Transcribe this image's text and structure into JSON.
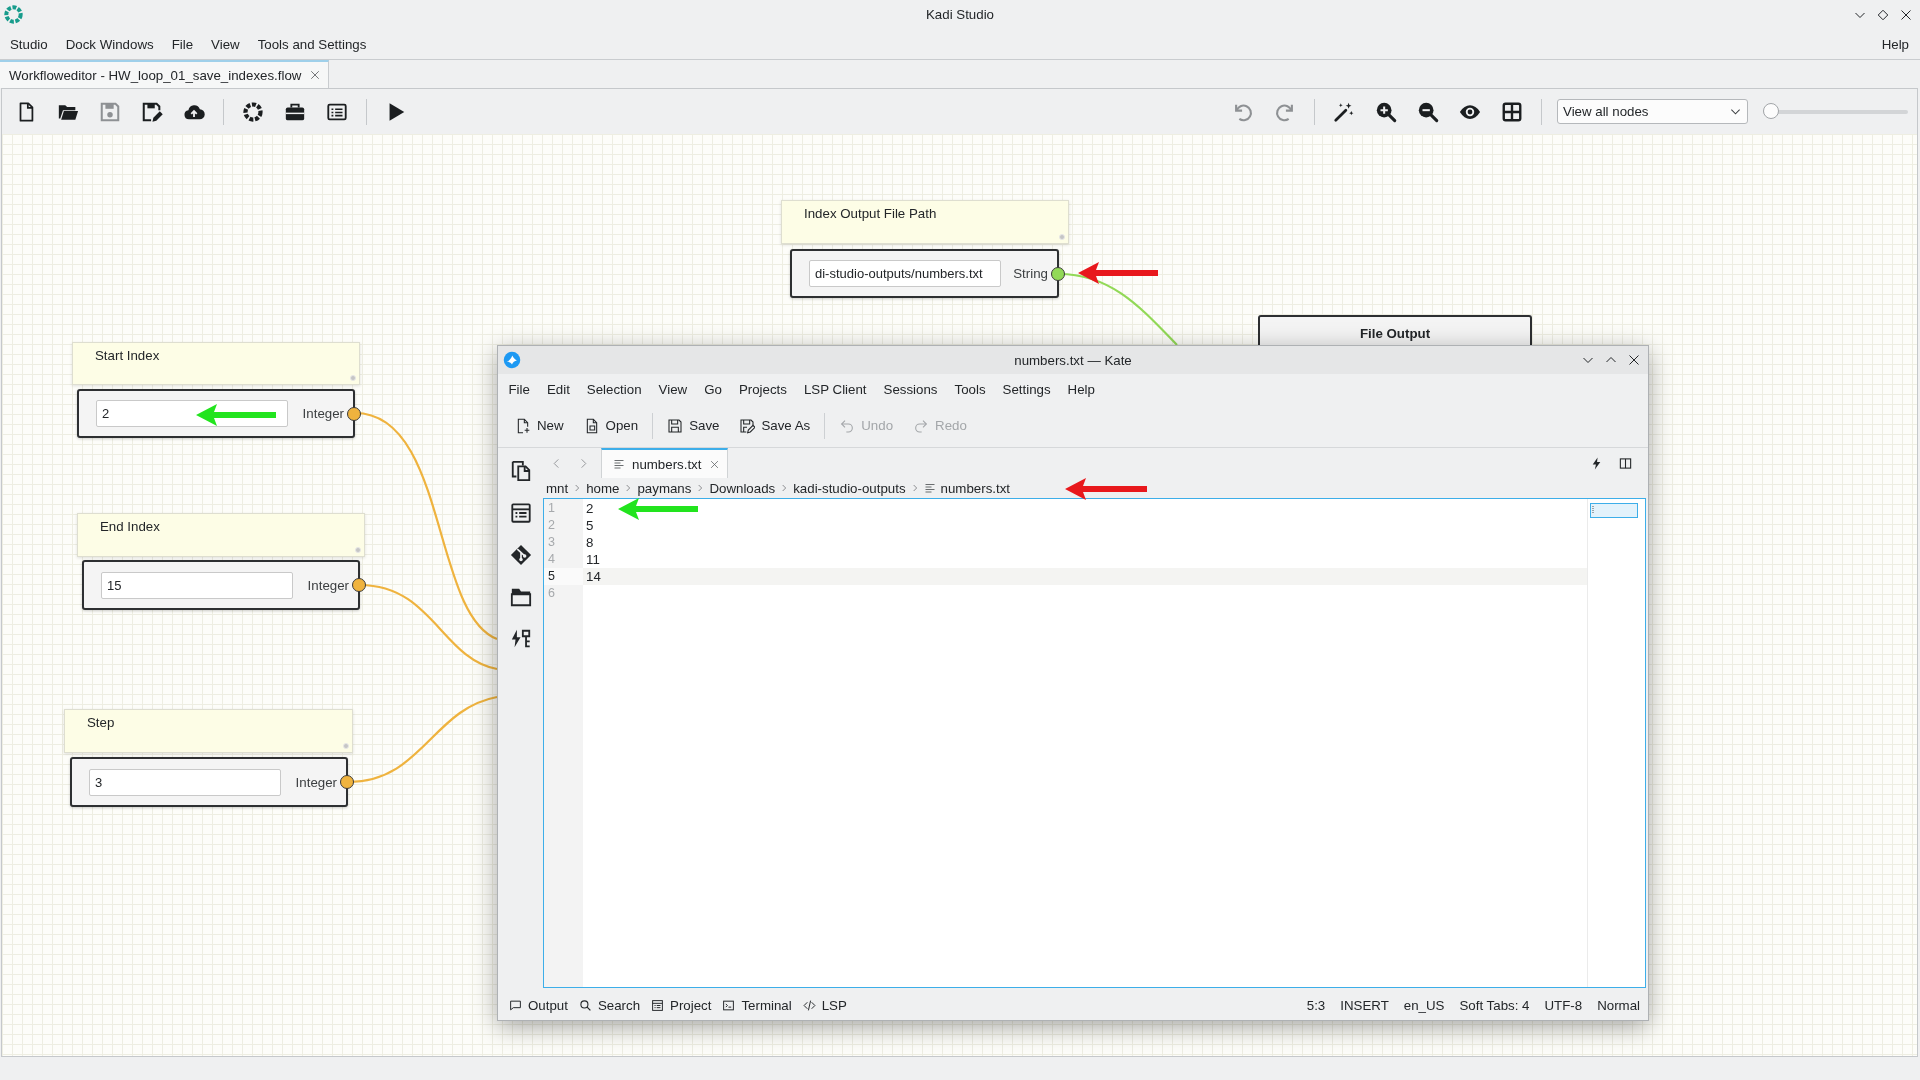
{
  "window": {
    "title": "Kadi Studio"
  },
  "menu": {
    "items": [
      "Studio",
      "Dock Windows",
      "File",
      "View",
      "Tools and Settings"
    ],
    "help": "Help"
  },
  "tabs": [
    {
      "label": "Workfloweditor - HW_loop_01_save_indexes.flow",
      "selected": true
    }
  ],
  "toolbar": {
    "left_groups": [
      {
        "buttons": [
          {
            "disabled": false
          },
          {
            "disabled": false
          },
          {
            "disabled": true
          },
          {
            "disabled": false
          },
          {
            "disabled": false
          }
        ]
      },
      {
        "buttons": [
          {
            "disabled": false
          },
          {
            "disabled": false
          },
          {
            "disabled": false
          }
        ]
      },
      {
        "buttons": [
          {
            "disabled": false
          }
        ]
      }
    ],
    "right_groups": [
      {
        "buttons": [
          {
            "disabled": true
          },
          {
            "disabled": true
          }
        ]
      },
      {
        "buttons": [
          {
            "disabled": false
          },
          {
            "disabled": false
          },
          {
            "disabled": false
          },
          {
            "disabled": false
          },
          {
            "disabled": false
          }
        ]
      }
    ],
    "view_select": {
      "value": "View all nodes"
    },
    "zoom_slider": {
      "level": 0
    }
  },
  "canvas": {
    "nodes": [
      {
        "kind": "input",
        "title": "Index Output File Path",
        "value": "di-studio-outputs/numbers.txt",
        "port": {
          "label": "String",
          "color": "#92d957"
        }
      },
      {
        "kind": "output",
        "title": "File Output"
      },
      {
        "kind": "input",
        "title": "Start Index",
        "value": "2",
        "port": {
          "label": "Integer",
          "color": "#efb33e"
        }
      },
      {
        "kind": "input",
        "title": "End Index",
        "value": "15",
        "port": {
          "label": "Integer",
          "color": "#efb33e"
        }
      },
      {
        "kind": "input",
        "title": "Step",
        "value": "3",
        "port": {
          "label": "Integer",
          "color": "#efb33e"
        }
      }
    ]
  },
  "editor_window": {
    "title": "numbers.txt — Kate",
    "menu": [
      "File",
      "Edit",
      "Selection",
      "View",
      "Go",
      "Projects",
      "LSP Client",
      "Sessions",
      "Tools",
      "Settings",
      "Help"
    ],
    "toolbar_groups": [
      {
        "buttons": [
          {
            "label": "New",
            "disabled": false
          },
          {
            "label": "Open",
            "disabled": false
          }
        ]
      },
      {
        "buttons": [
          {
            "label": "Save",
            "disabled": false
          },
          {
            "label": "Save As",
            "disabled": false
          }
        ]
      },
      {
        "buttons": [
          {
            "label": "Undo",
            "disabled": true
          },
          {
            "label": "Redo",
            "disabled": true
          }
        ]
      }
    ],
    "tabs": [
      {
        "label": "numbers.txt",
        "selected": true
      }
    ],
    "breadcrumb": [
      "mnt",
      "home",
      "paymans",
      "Downloads",
      "kadi-studio-outputs",
      "numbers.txt"
    ],
    "lines": [
      {
        "number": "1",
        "text": "2",
        "current": false
      },
      {
        "number": "2",
        "text": "5",
        "current": false
      },
      {
        "number": "3",
        "text": "8",
        "current": false
      },
      {
        "number": "4",
        "text": "11",
        "current": false
      },
      {
        "number": "5",
        "text": "14",
        "current": true
      },
      {
        "number": "6",
        "current": false
      }
    ],
    "status_left": [
      "Output",
      "Search",
      "Project",
      "Terminal",
      "LSP"
    ],
    "status_right": [
      "5:3",
      "INSERT",
      "en_US",
      "Soft Tabs: 4",
      "UTF-8",
      "Normal"
    ]
  },
  "annotations": [
    {
      "color": "#e8181c"
    },
    {
      "color": "#22e41e"
    },
    {
      "color": "#e8181c"
    },
    {
      "color": "#22e41e"
    }
  ]
}
